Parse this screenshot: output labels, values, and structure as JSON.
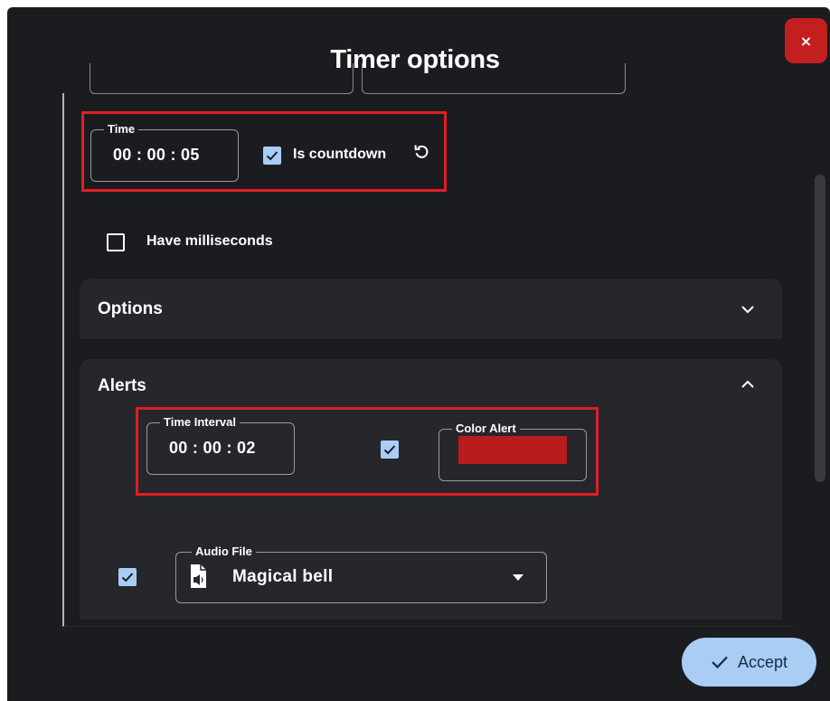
{
  "dialog": {
    "title": "Timer options",
    "close_label": "×",
    "accept_label": "Accept"
  },
  "time": {
    "label": "Time",
    "value": "00 : 00 : 05",
    "is_countdown_label": "Is countdown",
    "is_countdown_checked": true
  },
  "milliseconds": {
    "label": "Have milliseconds",
    "checked": false
  },
  "options_panel": {
    "title": "Options",
    "expanded": false
  },
  "alerts_panel": {
    "title": "Alerts",
    "expanded": true,
    "time_interval_label": "Time Interval",
    "time_interval_value": "00 : 00 : 02",
    "interval_checked": true,
    "color_alert_label": "Color Alert",
    "color_alert_value": "#b91c1c",
    "audio_checked": true,
    "audio_file_label": "Audio File",
    "audio_file_value": "Magical bell"
  },
  "colors": {
    "dialog_bg": "#1b1c20",
    "panel_bg": "#25272c",
    "accent": "#a9cdf4",
    "close_red": "#c31f1f",
    "highlight_red": "#e01e26"
  },
  "icons": [
    "close-icon",
    "check-icon",
    "reset-icon",
    "chevron-down-icon",
    "chevron-up-icon",
    "audio-file-icon",
    "dropdown-caret-icon"
  ]
}
